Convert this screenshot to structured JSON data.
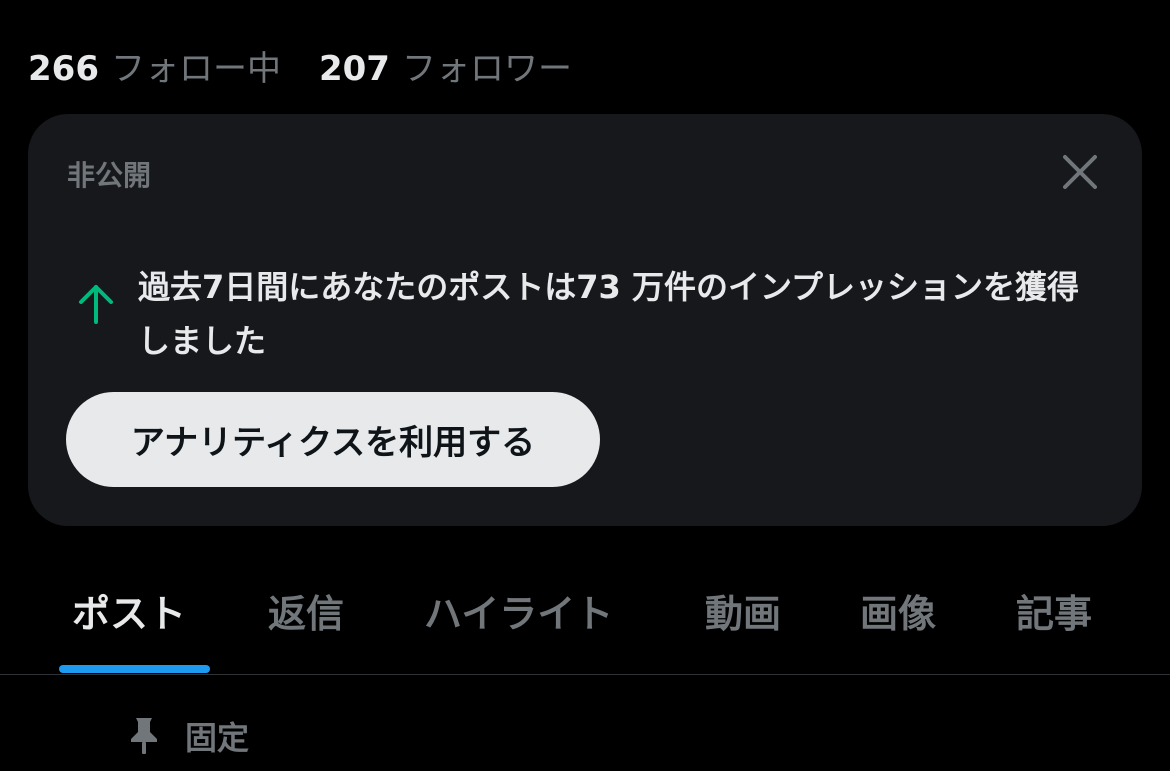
{
  "profile": {
    "following_count": "266",
    "following_label": "フォロー中",
    "followers_count": "207",
    "followers_label": "フォロワー"
  },
  "insight_card": {
    "tag": "非公開",
    "message": "過去7日間にあなたのポストは73 万件のインプレッションを獲得しました",
    "trend_icon": "arrow-up-icon",
    "close_icon": "close-icon",
    "cta_label": "アナリティクスを利用する"
  },
  "tabs": [
    {
      "label": "ポスト",
      "active": true
    },
    {
      "label": "返信",
      "active": false
    },
    {
      "label": "ハイライト",
      "active": false
    },
    {
      "label": "動画",
      "active": false
    },
    {
      "label": "画像",
      "active": false
    },
    {
      "label": "記事",
      "active": false
    }
  ],
  "pinned": {
    "icon": "pin-icon",
    "label": "固定"
  },
  "colors": {
    "background": "#000000",
    "card": "#16181c",
    "accent": "#1d9bf0",
    "trend_up": "#00ba7c",
    "muted_text": "#71767b",
    "primary_text": "#e7e9ea"
  }
}
